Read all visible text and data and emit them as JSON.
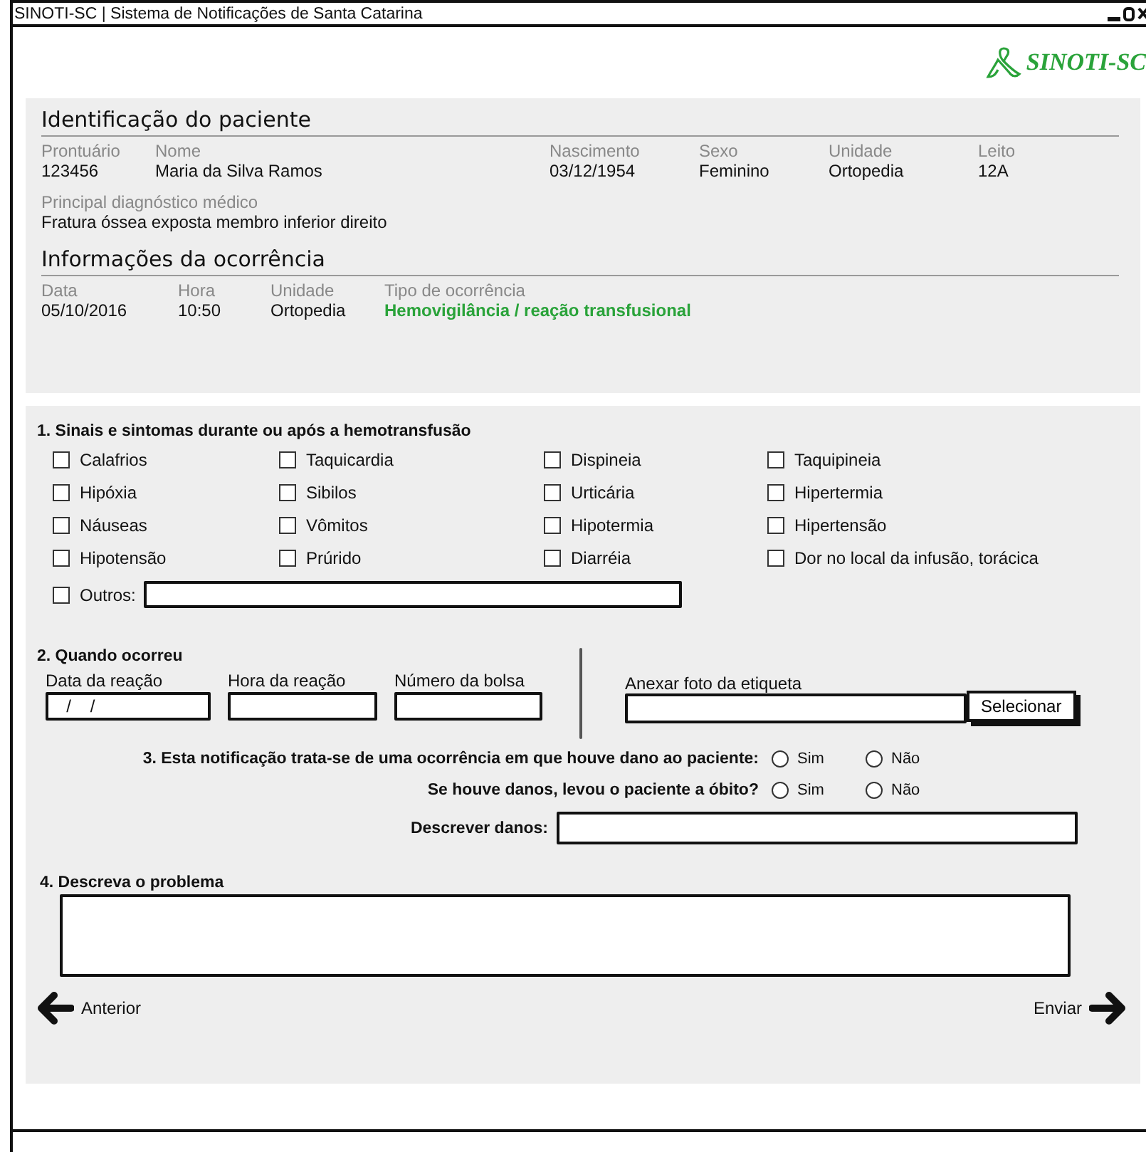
{
  "window": {
    "title": "SINOTI-SC | Sistema de Notificações de Santa Catarina"
  },
  "logo": {
    "text": "SINOTI-SC"
  },
  "patient": {
    "heading": "Identificação do paciente",
    "fields": [
      {
        "label": "Prontuário",
        "value": "123456"
      },
      {
        "label": "Nome",
        "value": "Maria da Silva Ramos"
      },
      {
        "label": "Nascimento",
        "value": "03/12/1954"
      },
      {
        "label": "Sexo",
        "value": "Feminino"
      },
      {
        "label": "Unidade",
        "value": "Ortopedia"
      },
      {
        "label": "Leito",
        "value": "12A"
      }
    ],
    "diagnosis": {
      "label": "Principal diagnóstico médico",
      "value": "Fratura óssea exposta membro inferior direito"
    }
  },
  "occurrence": {
    "heading": "Informações da ocorrência",
    "fields": [
      {
        "label": "Data",
        "value": "05/10/2016",
        "kind": "plain"
      },
      {
        "label": "Hora",
        "value": "10:50",
        "kind": "plain"
      },
      {
        "label": "Unidade",
        "value": "Ortopedia",
        "kind": "plain"
      },
      {
        "label": "Tipo de ocorrência",
        "value": "Hemovigilância / reação transfusional",
        "kind": "highlight"
      }
    ]
  },
  "symptoms": {
    "title": "1. Sinais e sintomas durante ou após a hemotransfusão",
    "items": [
      {
        "label": "Calafrios",
        "checked": false
      },
      {
        "label": "Taquicardia",
        "checked": false
      },
      {
        "label": "Dispineia",
        "checked": false
      },
      {
        "label": "Taquipineia",
        "checked": false
      },
      {
        "label": "Hipóxia",
        "checked": false
      },
      {
        "label": "Sibilos",
        "checked": false
      },
      {
        "label": "Urticária",
        "checked": false
      },
      {
        "label": "Hipertermia",
        "checked": false
      },
      {
        "label": "Náuseas",
        "checked": false
      },
      {
        "label": "Vômitos",
        "checked": false
      },
      {
        "label": "Hipotermia",
        "checked": false
      },
      {
        "label": "Hipertensão",
        "checked": false
      },
      {
        "label": "Hipotensão",
        "checked": false
      },
      {
        "label": "Prúrido",
        "checked": false
      },
      {
        "label": "Diarréia",
        "checked": false
      },
      {
        "label": "Dor no local da infusão, torácica",
        "checked": false
      }
    ],
    "other": {
      "label": "Outros:",
      "checked": false
    }
  },
  "when": {
    "title": "2. Quando ocorreu",
    "fields": [
      {
        "label": "Data da reação",
        "value": "  /    /"
      },
      {
        "label": "Hora da reação"
      },
      {
        "label": "Número da bolsa"
      }
    ],
    "attach": {
      "label": "Anexar foto da etiqueta",
      "button": "Selecionar"
    }
  },
  "damage": {
    "questions": [
      {
        "text": "3. Esta notificação trata-se de uma ocorrência em que houve dano ao paciente:",
        "options": [
          {
            "label": "Sim",
            "selected": false
          },
          {
            "label": "Não",
            "selected": false
          }
        ]
      },
      {
        "text": "Se houve danos, levou o paciente a óbito?",
        "options": [
          {
            "label": "Sim",
            "selected": false
          },
          {
            "label": "Não",
            "selected": false
          }
        ]
      }
    ],
    "describe": {
      "label": "Descrever danos:"
    }
  },
  "problem": {
    "title": "4. Descreva o problema"
  },
  "nav": {
    "previous": "Anterior",
    "next": "Enviar"
  }
}
